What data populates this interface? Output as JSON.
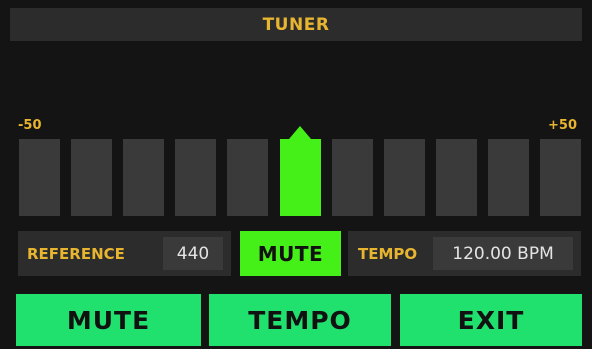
{
  "title": "TUNER",
  "scale": {
    "min_label": "-50",
    "max_label": "+50"
  },
  "meter": {
    "segment_count": 11,
    "active_segment": 5,
    "active_color": "#45f018",
    "inactive_color": "#3a3a3a"
  },
  "reference": {
    "label": "REFERENCE",
    "value": "440"
  },
  "mute_indicator": "MUTE",
  "tempo": {
    "label": "TEMPO",
    "value": "120.00 BPM"
  },
  "softkeys": [
    {
      "label": "MUTE"
    },
    {
      "label": "TEMPO"
    },
    {
      "label": "EXIT"
    }
  ],
  "colors": {
    "accent": "#e8b530",
    "button": "#20e06e",
    "indicator": "#45f018"
  }
}
